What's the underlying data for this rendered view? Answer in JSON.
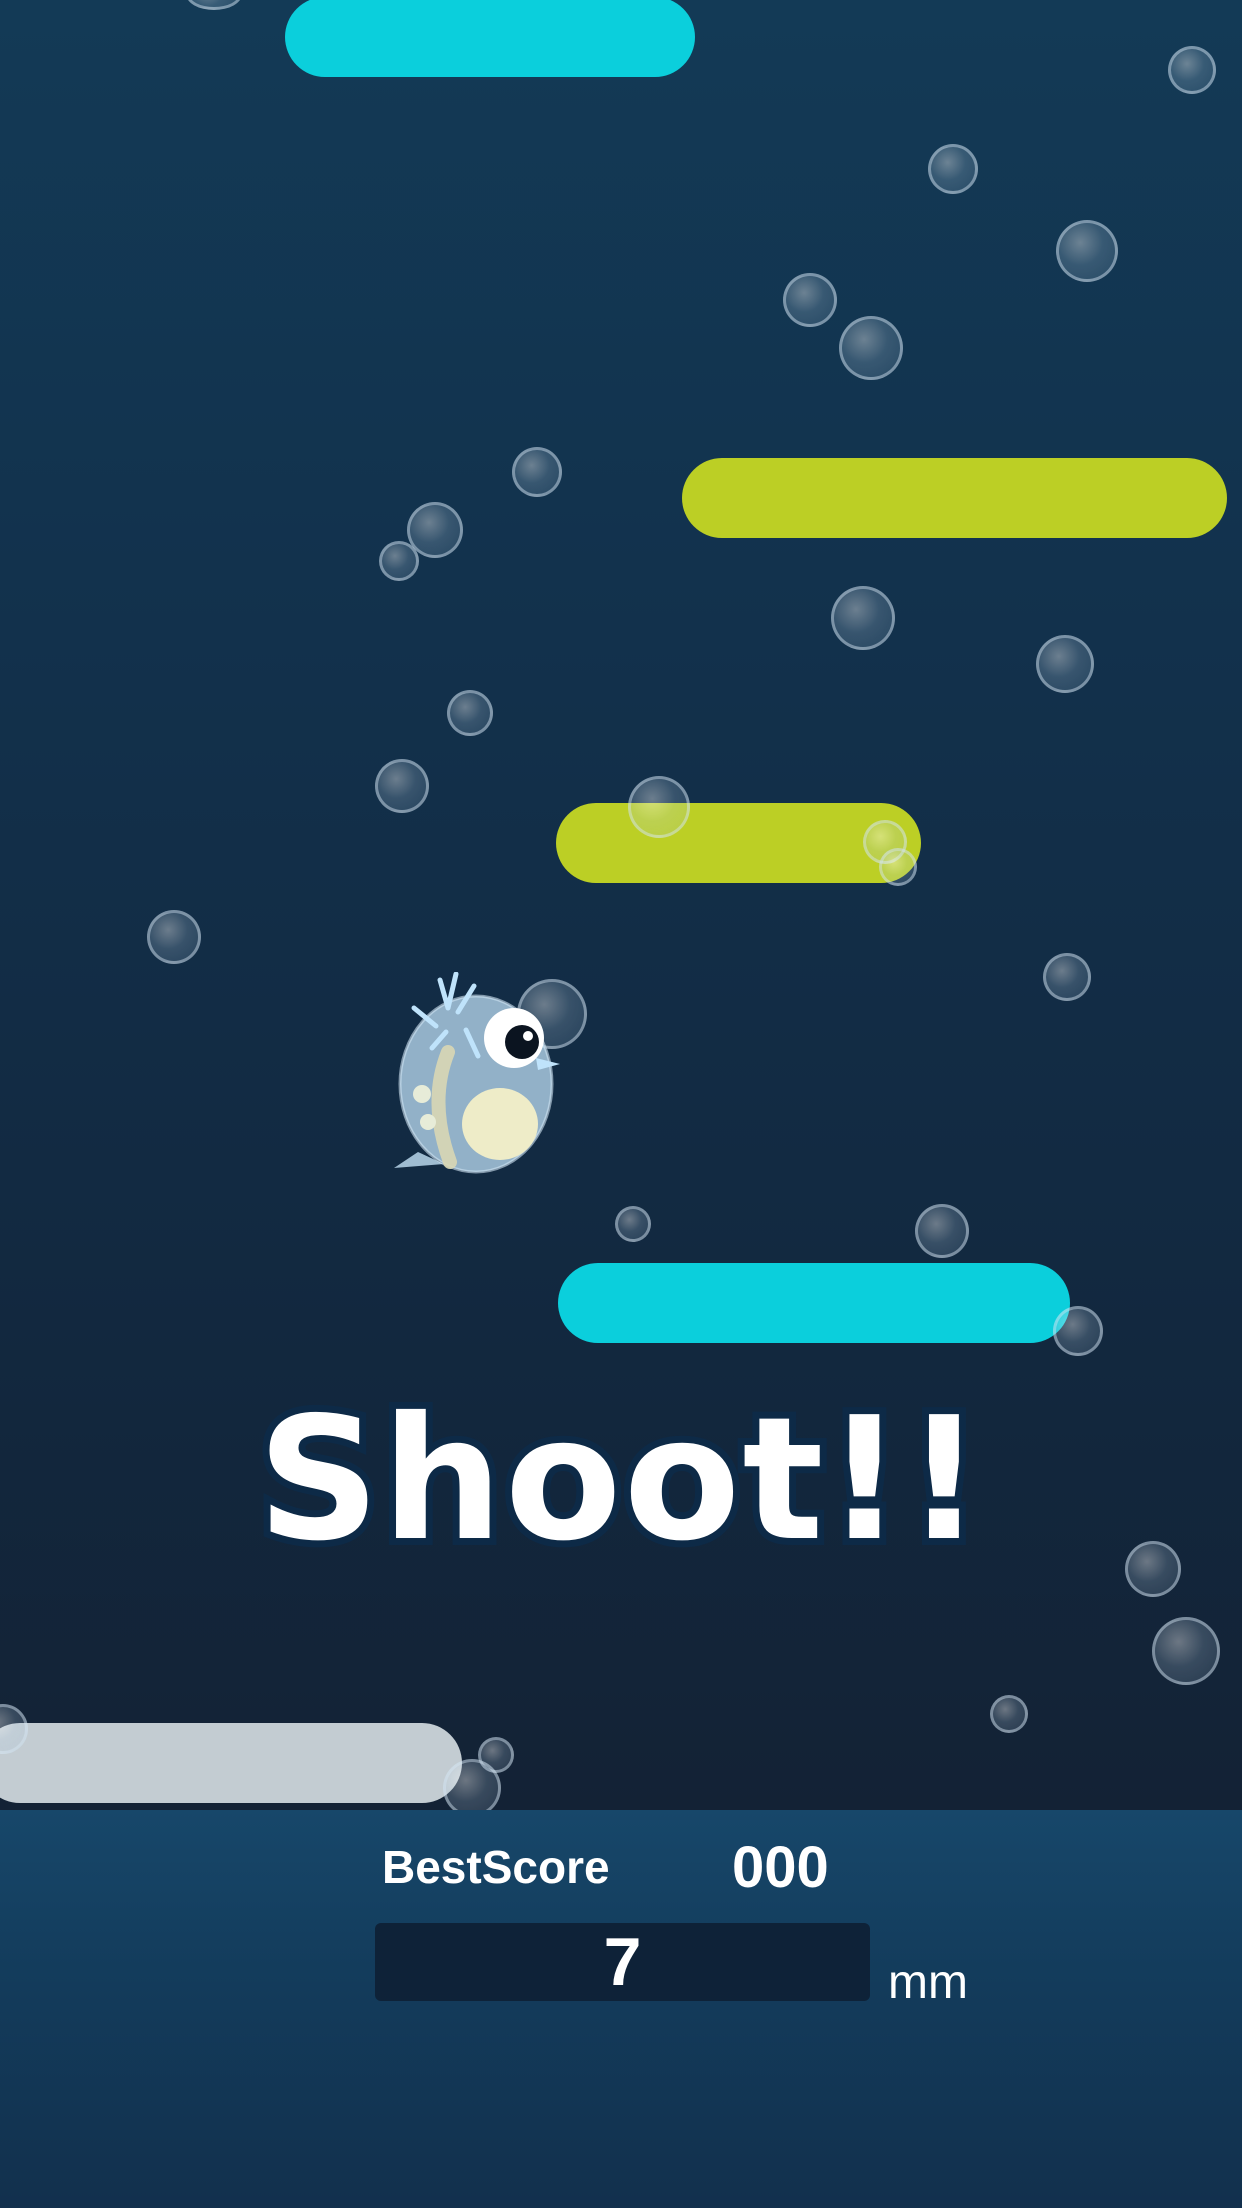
{
  "game": {
    "shoot_text": "Shoot!!",
    "best_score_label": "BestScore",
    "best_score_value": "000",
    "current_score": "7",
    "score_unit": "mm"
  },
  "colors": {
    "platform_cyan": "#0bcfdc",
    "platform_lime": "#bccf25",
    "platform_gray": "#c3ccd2",
    "background_top": "#133a56",
    "background_bottom": "#132235",
    "score_panel": "#0e2238",
    "text": "#ffffff"
  },
  "icons": {
    "character": "bird-character-icon",
    "bubbles": "bubble-icon"
  }
}
